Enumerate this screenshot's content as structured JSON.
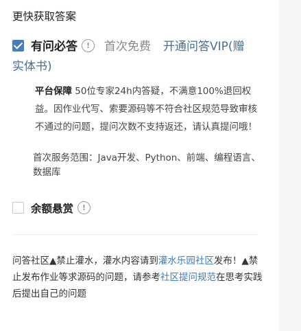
{
  "header": {
    "title": "更快获取答案"
  },
  "option_paid": {
    "checked": true,
    "name": "有问必答",
    "help_icon": "!",
    "free_text": "首次免费",
    "vip_text_line1": "开通问答VIP(赠",
    "vip_text_line2": "实体书)"
  },
  "guarantee": {
    "label": "平台保障",
    "text": " 50位专家24h内答疑，不满意100%退回权益。因作业代写、索要源码等不符合社区规范导致审核不通过的问题，提问次数不支持返还，请认真提问哦！"
  },
  "scope": {
    "text": "首次服务范围：Java开发、Python、前端、编程语言、数据库"
  },
  "option_bounty": {
    "checked": false,
    "name": "余额悬赏",
    "help_icon": "!"
  },
  "rules": {
    "part1": "问答社区▲禁止灌水，灌水内容请到",
    "link1": "灌水乐园社区",
    "part2": "发布！▲禁止发布作业等求源码的问题，请参考",
    "link2": "社区提问规范",
    "part3": "在思考实践后提出自己的问题"
  },
  "colors": {
    "accent": "#4a7db8",
    "link": "#3e7cb4",
    "sidebar_bg": "#f5f6f7"
  }
}
